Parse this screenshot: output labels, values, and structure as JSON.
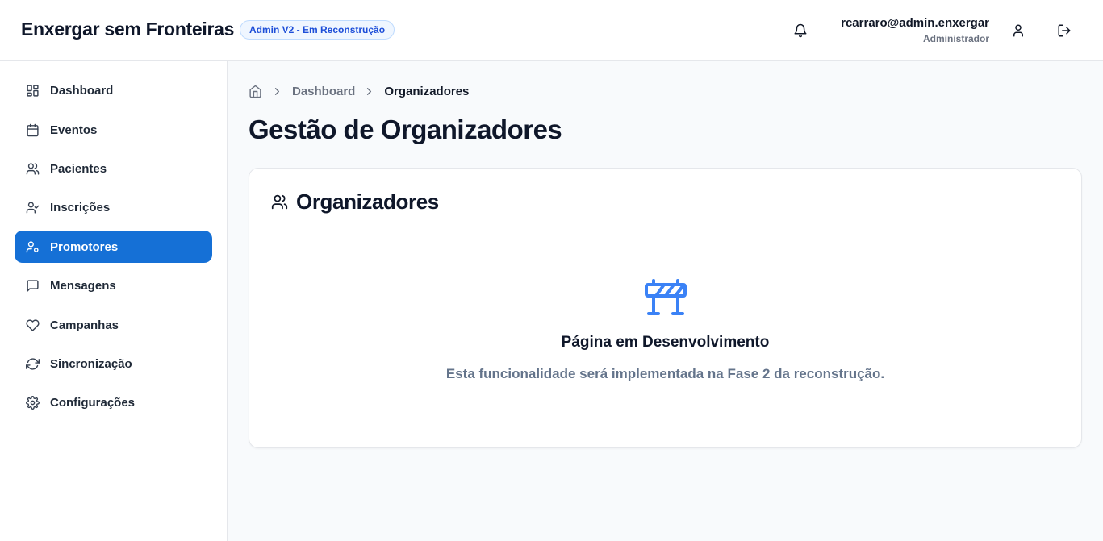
{
  "header": {
    "brand": "Enxergar sem Fronteiras",
    "badge": "Admin V2 - Em Reconstrução",
    "user_email": "rcarraro@admin.enxergar",
    "user_role": "Administrador",
    "icons": [
      "bell-icon",
      "user-icon",
      "logout-icon"
    ]
  },
  "sidebar": {
    "items": [
      {
        "label": "Dashboard",
        "icon": "layout-grid-icon"
      },
      {
        "label": "Eventos",
        "icon": "calendar-icon"
      },
      {
        "label": "Pacientes",
        "icon": "users-icon"
      },
      {
        "label": "Inscrições",
        "icon": "user-check-icon"
      },
      {
        "label": "Promotores",
        "icon": "user-cog-icon",
        "active": true
      },
      {
        "label": "Mensagens",
        "icon": "message-square-icon"
      },
      {
        "label": "Campanhas",
        "icon": "heart-icon"
      },
      {
        "label": "Sincronização",
        "icon": "refresh-icon"
      },
      {
        "label": "Configurações",
        "icon": "settings-icon"
      }
    ]
  },
  "breadcrumb": {
    "items": [
      "Dashboard",
      "Organizadores"
    ]
  },
  "page": {
    "title": "Gestão de Organizadores"
  },
  "card": {
    "title": "Organizadores",
    "wip_title": "Página em Desenvolvimento",
    "wip_description": "Esta funcionalidade será implementada na Fase 2 da reconstrução."
  },
  "colors": {
    "accent": "#1570d6",
    "wip_icon": "#3b82f6",
    "badge_text": "#1d4ed8"
  }
}
